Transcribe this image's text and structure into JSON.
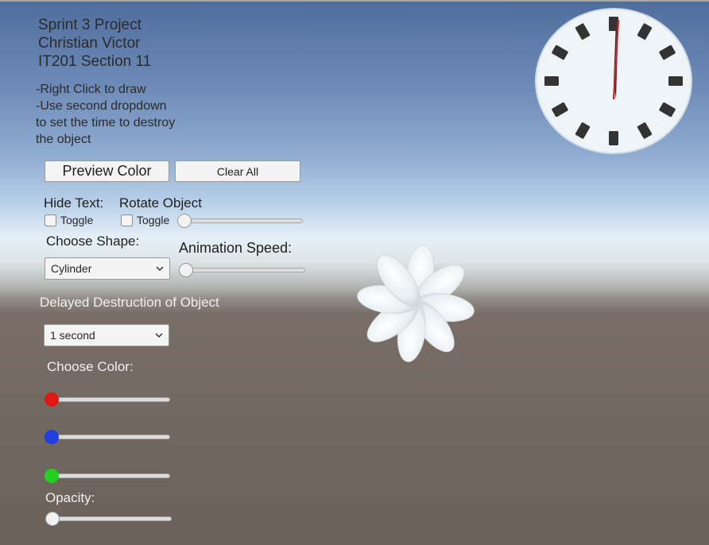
{
  "header": {
    "title_line1": "Sprint 3 Project",
    "title_line2": "Christian Victor",
    "title_line3": "IT201 Section 11"
  },
  "instructions": {
    "line1": "-Right Click to draw",
    "line2": "-Use second dropdown",
    "line3": "to set the time to destroy",
    "line4": "the object"
  },
  "buttons": {
    "preview_color": "Preview Color",
    "clear_all": "Clear All"
  },
  "hide_text": {
    "label": "Hide Text:",
    "toggle_label": "Toggle",
    "checked": false
  },
  "rotate_object": {
    "label": "Rotate Object",
    "toggle_label": "Toggle",
    "checked": false,
    "slider_value": 0
  },
  "shape": {
    "label": "Choose Shape:",
    "selected": "Cylinder"
  },
  "animation_speed": {
    "label": "Animation Speed:",
    "slider_value": 0
  },
  "destruction": {
    "label": "Delayed Destruction of Object",
    "selected": "1 second"
  },
  "color": {
    "label": "Choose Color:",
    "sliders": [
      {
        "name": "red",
        "knob_color": "#e01818",
        "value": 0
      },
      {
        "name": "blue",
        "knob_color": "#1f3fe0",
        "value": 0
      },
      {
        "name": "green",
        "knob_color": "#22d022",
        "value": 0
      }
    ]
  },
  "opacity": {
    "label": "Opacity:",
    "value": 0
  },
  "icons": {
    "clock": "wall-clock-icon",
    "flower": "flower-shape-icon",
    "dropdown": "chevron-down-icon"
  },
  "colors": {
    "sky_top": "#4f6d9c",
    "horizon": "#e6f0f8",
    "ground": "#6a615b",
    "clock_hand": "#c8242c"
  }
}
